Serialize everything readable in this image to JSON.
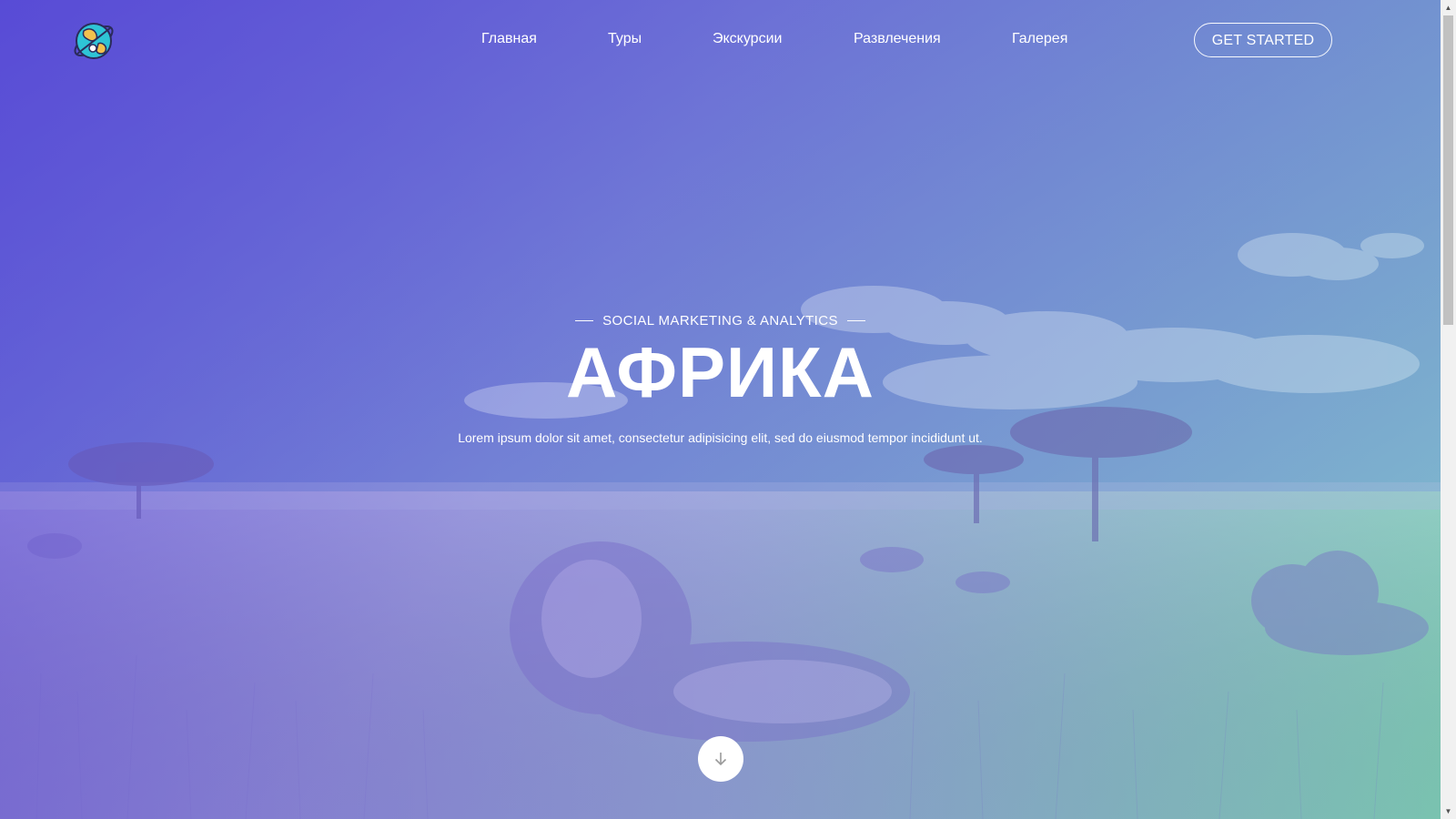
{
  "nav": {
    "links": [
      {
        "label": "Главная"
      },
      {
        "label": "Туры"
      },
      {
        "label": "Экскурсии"
      },
      {
        "label": "Развлечения"
      },
      {
        "label": "Галерея"
      }
    ],
    "cta_label": "GET STARTED"
  },
  "hero": {
    "subtitle": "SOCIAL MARKETING & ANALYTICS",
    "title": "АФРИКА",
    "lead": "Lorem ipsum dolor sit amet, consectetur adipisicing elit, sed do eiusmod tempor incididunt ut."
  },
  "icons": {
    "logo": "globe-planet-icon",
    "scroll": "arrow-down-icon",
    "scroll_up": "chevron-up-icon",
    "scroll_down": "chevron-down-icon"
  },
  "colors": {
    "gradient_start": "#5a4fd6",
    "gradient_end": "#7fd1b9",
    "text": "#ffffff",
    "button_bg": "#ffffff",
    "arrow": "#9a9a9a"
  }
}
